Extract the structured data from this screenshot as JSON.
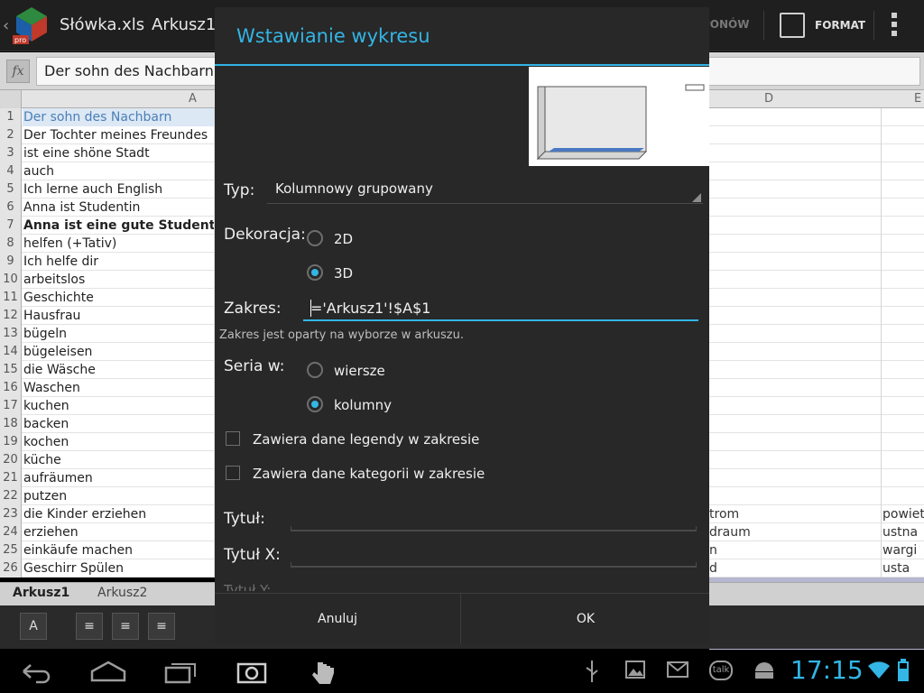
{
  "app": {
    "file_name": "Słówka.xls",
    "sheet_name": "Arkusz1",
    "redo_label": "PONÓW",
    "format_label": "FORMAT"
  },
  "formula": {
    "fx_label": "fx",
    "value": "Der sohn des Nachbarn"
  },
  "columns": [
    "A",
    "D",
    "E"
  ],
  "rows": [
    {
      "n": "1",
      "a": "Der sohn des Nachbarn",
      "d": "",
      "e": ""
    },
    {
      "n": "2",
      "a": "Der Tochter meines Freundes",
      "d": "",
      "e": ""
    },
    {
      "n": "3",
      "a": "ist eine shöne Stadt",
      "d": "",
      "e": ""
    },
    {
      "n": "4",
      "a": "auch",
      "d": "",
      "e": ""
    },
    {
      "n": "5",
      "a": "Ich lerne auch English",
      "d": "",
      "e": ""
    },
    {
      "n": "6",
      "a": "Anna ist Studentin",
      "d": "",
      "e": ""
    },
    {
      "n": "7",
      "a": "Anna ist eine gute Studentin",
      "d": "",
      "e": ""
    },
    {
      "n": "8",
      "a": "helfen (+Tativ)",
      "d": "",
      "e": ""
    },
    {
      "n": "9",
      "a": "Ich helfe dir",
      "d": "",
      "e": ""
    },
    {
      "n": "10",
      "a": "arbeitslos",
      "d": "",
      "e": ""
    },
    {
      "n": "11",
      "a": "Geschichte",
      "d": "",
      "e": ""
    },
    {
      "n": "12",
      "a": "Hausfrau",
      "d": "",
      "e": ""
    },
    {
      "n": "13",
      "a": "bügeln",
      "d": "",
      "e": ""
    },
    {
      "n": "14",
      "a": "bügeleisen",
      "d": "",
      "e": ""
    },
    {
      "n": "15",
      "a": "die Wäsche",
      "d": "",
      "e": ""
    },
    {
      "n": "16",
      "a": "Waschen",
      "d": "",
      "e": ""
    },
    {
      "n": "17",
      "a": "kuchen",
      "d": "",
      "e": ""
    },
    {
      "n": "18",
      "a": "backen",
      "d": "",
      "e": ""
    },
    {
      "n": "19",
      "a": "kochen",
      "d": "",
      "e": ""
    },
    {
      "n": "20",
      "a": "küche",
      "d": "",
      "e": ""
    },
    {
      "n": "21",
      "a": "aufräumen",
      "d": "",
      "e": ""
    },
    {
      "n": "22",
      "a": "putzen",
      "d": "",
      "e": ""
    },
    {
      "n": "23",
      "a": "die Kinder erziehen",
      "d": "trom",
      "e": "powiet"
    },
    {
      "n": "24",
      "a": "erziehen",
      "d": "draum",
      "e": "ustna"
    },
    {
      "n": "25",
      "a": "einkäufe machen",
      "d": "n",
      "e": "wargi"
    },
    {
      "n": "26",
      "a": "Geschirr Spülen",
      "d": "d",
      "e": "usta"
    }
  ],
  "sheet_tabs": [
    "Arkusz1",
    "Arkusz2"
  ],
  "dialog": {
    "title": "Wstawianie wykresu",
    "type_label": "Typ:",
    "type_value": "Kolumnowy grupowany",
    "decoration_label": "Dekoracja:",
    "decoration_options": [
      "2D",
      "3D"
    ],
    "decoration_selected": "3D",
    "range_label": "Zakres:",
    "range_value": "='Arkusz1'!$A$1",
    "range_hint": "Zakres jest oparty na wyborze w arkuszu.",
    "series_label": "Seria w:",
    "series_options": [
      "wiersze",
      "kolumny"
    ],
    "series_selected": "kolumny",
    "legend_checkbox": "Zawiera dane legendy w zakresie",
    "category_checkbox": "Zawiera dane kategorii w zakresie",
    "title_label": "Tytuł:",
    "title_x_label": "Tytuł X:",
    "title_y_label": "Tytuł Y:",
    "cancel_label": "Anuluj",
    "ok_label": "OK"
  },
  "status": {
    "time": "17:15",
    "talk_label": "talk"
  },
  "colors": {
    "accent": "#33b5e5",
    "dialog_bg": "#282828",
    "selected_cell": "#4a7fb8"
  }
}
